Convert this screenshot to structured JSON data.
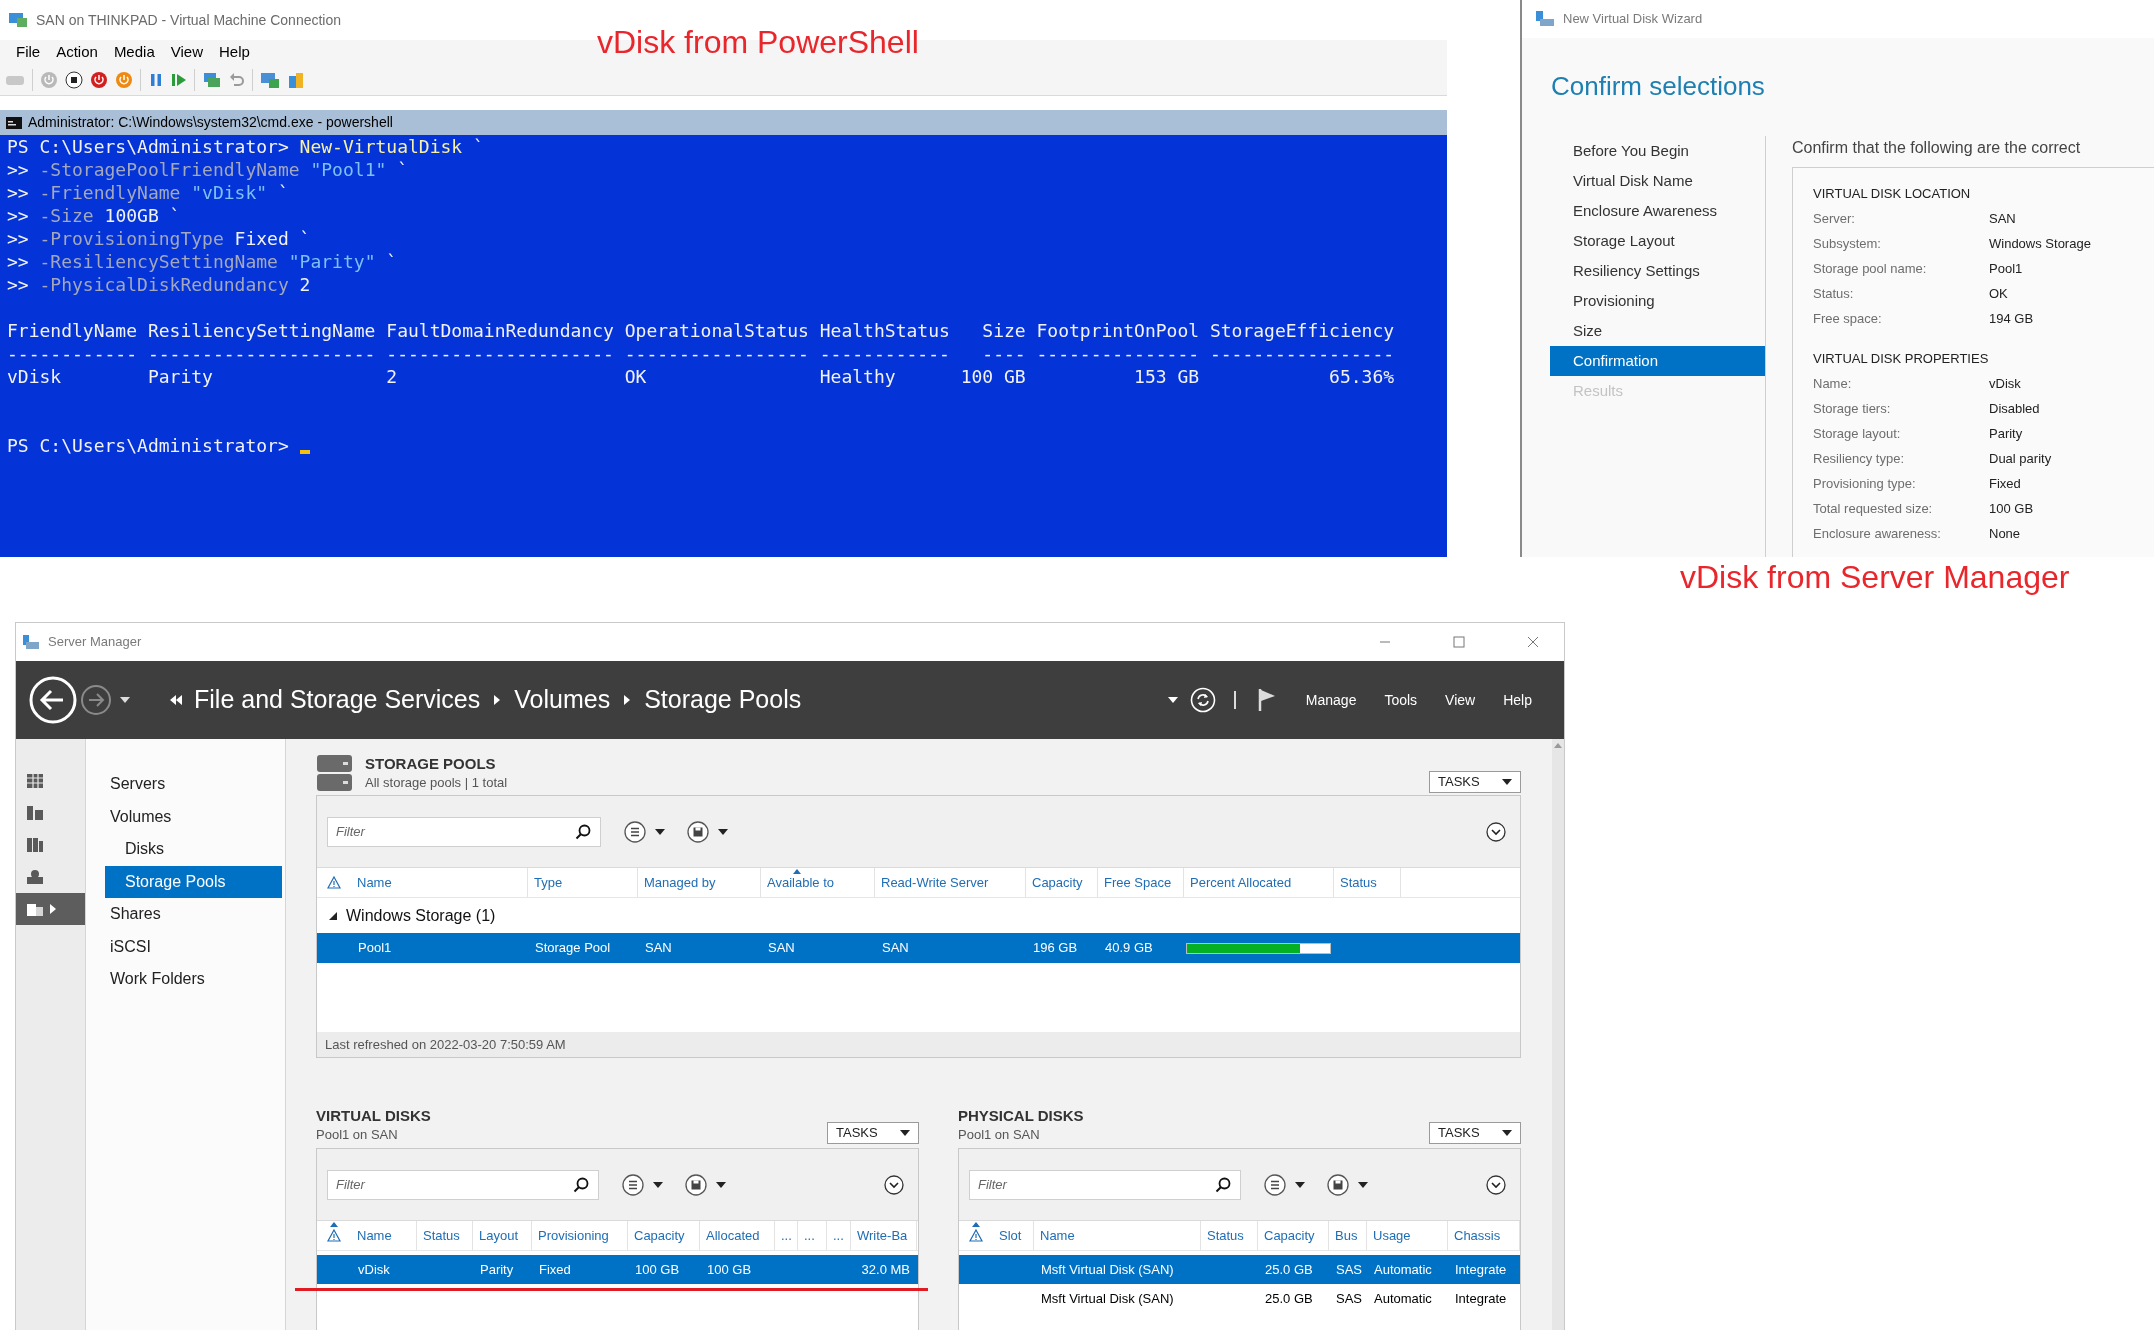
{
  "vm_window": {
    "title": "SAN on THINKPAD - Virtual Machine Connection",
    "menu": [
      "File",
      "Action",
      "Media",
      "View",
      "Help"
    ],
    "console": {
      "title": "Administrator: C:\\Windows\\system32\\cmd.exe - powershell",
      "command_lines": [
        [
          {
            "text": "PS C:\\Users\\Administrator> ",
            "kind": "prompt"
          },
          {
            "text": "New-VirtualDisk",
            "kind": "command"
          },
          {
            "text": " `",
            "kind": "plain"
          }
        ],
        [
          {
            "text": ">> ",
            "kind": "prompt"
          },
          {
            "text": "-StoragePoolFriendlyName",
            "kind": "param"
          },
          {
            "text": " \"Pool1\"",
            "kind": "string"
          },
          {
            "text": " `",
            "kind": "plain"
          }
        ],
        [
          {
            "text": ">> ",
            "kind": "prompt"
          },
          {
            "text": "-FriendlyName",
            "kind": "param"
          },
          {
            "text": " \"vDisk\"",
            "kind": "string"
          },
          {
            "text": " `",
            "kind": "plain"
          }
        ],
        [
          {
            "text": ">> ",
            "kind": "prompt"
          },
          {
            "text": "-Size",
            "kind": "param"
          },
          {
            "text": " 100GB `",
            "kind": "plain"
          }
        ],
        [
          {
            "text": ">> ",
            "kind": "prompt"
          },
          {
            "text": "-ProvisioningType",
            "kind": "param"
          },
          {
            "text": " Fixed `",
            "kind": "plain"
          }
        ],
        [
          {
            "text": ">> ",
            "kind": "prompt"
          },
          {
            "text": "-ResiliencySettingName",
            "kind": "param"
          },
          {
            "text": " \"Parity\"",
            "kind": "string"
          },
          {
            "text": " `",
            "kind": "plain"
          }
        ],
        [
          {
            "text": ">> ",
            "kind": "prompt"
          },
          {
            "text": "-PhysicalDiskRedundancy",
            "kind": "param"
          },
          {
            "text": " 2",
            "kind": "plain"
          }
        ]
      ],
      "output_lines": [
        "FriendlyName ResiliencySettingName FaultDomainRedundancy OperationalStatus HealthStatus   Size FootprintOnPool StorageEfficiency",
        "------------ --------------------- --------------------- ----------------- ------------   ---- --------------- -----------------",
        "vDisk        Parity                2                     OK                Healthy      100 GB          153 GB            65.36%"
      ],
      "prompt": "PS C:\\Users\\Administrator> "
    }
  },
  "annotations": [
    {
      "text": "vDisk from PowerShell"
    },
    {
      "text": "vDisk from Server Manager"
    }
  ],
  "wizard": {
    "title": "New Virtual Disk Wizard",
    "heading": "Confirm selections",
    "steps": [
      {
        "label": "Before You Begin",
        "selected": false,
        "disabled": false
      },
      {
        "label": "Virtual Disk Name",
        "selected": false,
        "disabled": false
      },
      {
        "label": "Enclosure Awareness",
        "selected": false,
        "disabled": false
      },
      {
        "label": "Storage Layout",
        "selected": false,
        "disabled": false
      },
      {
        "label": "Resiliency Settings",
        "selected": false,
        "disabled": false
      },
      {
        "label": "Provisioning",
        "selected": false,
        "disabled": false
      },
      {
        "label": "Size",
        "selected": false,
        "disabled": false
      },
      {
        "label": "Confirmation",
        "selected": true,
        "disabled": false
      },
      {
        "label": "Results",
        "selected": false,
        "disabled": true
      }
    ],
    "intro": "Confirm that the following are the correct",
    "sections": [
      {
        "heading": "VIRTUAL DISK LOCATION",
        "rows": [
          {
            "label": "Server:",
            "value": "SAN"
          },
          {
            "label": "Subsystem:",
            "value": "Windows Storage"
          },
          {
            "label": "Storage pool name:",
            "value": "Pool1"
          },
          {
            "label": "Status:",
            "value": "OK"
          },
          {
            "label": "Free space:",
            "value": "194 GB"
          }
        ]
      },
      {
        "heading": "VIRTUAL DISK PROPERTIES",
        "rows": [
          {
            "label": "Name:",
            "value": "vDisk"
          },
          {
            "label": "Storage tiers:",
            "value": "Disabled"
          },
          {
            "label": "Storage layout:",
            "value": "Parity"
          },
          {
            "label": "Resiliency type:",
            "value": "Dual parity"
          },
          {
            "label": "Provisioning type:",
            "value": "Fixed"
          },
          {
            "label": "Total requested size:",
            "value": "100 GB"
          },
          {
            "label": "Enclosure awareness:",
            "value": "None"
          }
        ]
      }
    ]
  },
  "server_manager": {
    "title": "Server Manager",
    "breadcrumb": [
      "File and Storage Services",
      "Volumes",
      "Storage Pools"
    ],
    "menu": [
      "Manage",
      "Tools",
      "View",
      "Help"
    ],
    "rail": [
      {
        "kind": "dashboard",
        "selected": false
      },
      {
        "kind": "local_server",
        "selected": false
      },
      {
        "kind": "all_servers",
        "selected": false
      },
      {
        "kind": "roles",
        "selected": false
      },
      {
        "kind": "file_storage",
        "selected": true
      }
    ],
    "nav": [
      {
        "label": "Servers",
        "selected": false
      },
      {
        "label": "Volumes",
        "selected": false,
        "children": [
          {
            "label": "Disks",
            "selected": false
          },
          {
            "label": "Storage Pools",
            "selected": true
          }
        ]
      },
      {
        "label": "Shares",
        "selected": false
      },
      {
        "label": "iSCSI",
        "selected": false
      },
      {
        "label": "Work Folders",
        "selected": false
      }
    ],
    "storage_pools": {
      "title": "STORAGE POOLS",
      "subtitle": "All storage pools | 1 total",
      "tasks": "TASKS",
      "filter_placeholder": "Filter",
      "columns": [
        {
          "label": "Name",
          "sorted": false
        },
        {
          "label": "Type",
          "sorted": false
        },
        {
          "label": "Managed by",
          "sorted": false
        },
        {
          "label": "Available to",
          "sorted": true
        },
        {
          "label": "Read-Write Server",
          "sorted": false
        },
        {
          "label": "Capacity",
          "sorted": false
        },
        {
          "label": "Free Space",
          "sorted": false
        },
        {
          "label": "Percent Allocated",
          "sorted": false
        },
        {
          "label": "Status",
          "sorted": false
        }
      ],
      "groups": [
        {
          "label": "Windows Storage (1)",
          "expanded": true,
          "rows": [
            {
              "selected": true,
              "name": "Pool1",
              "type": "Storage Pool",
              "managed_by": "SAN",
              "available_to": "SAN",
              "read_write_server": "SAN",
              "capacity": "196 GB",
              "free_space": "40.9 GB",
              "level": 0.79
            }
          ]
        }
      ],
      "footer": "Last refreshed on 2022-03-20 7:50:59 AM"
    },
    "virtual_disks": {
      "title": "VIRTUAL DISKS",
      "subtitle": "Pool1 on SAN",
      "tasks": "TASKS",
      "filter_placeholder": "Filter",
      "columns": [
        "Name",
        "Status",
        "Layout",
        "Provisioning",
        "Capacity",
        "Allocated",
        "...",
        "...",
        "...",
        "Write-Ba"
      ],
      "rows": [
        {
          "selected": true,
          "name": "vDisk",
          "layout": "Parity",
          "provisioning": "Fixed",
          "capacity": "100 GB",
          "allocated": "100 GB",
          "write_ba": "32.0 MB"
        }
      ]
    },
    "physical_disks": {
      "title": "PHYSICAL DISKS",
      "subtitle": "Pool1 on SAN",
      "tasks": "TASKS",
      "filter_placeholder": "Filter",
      "columns": [
        "Slot",
        "Name",
        "Status",
        "Capacity",
        "Bus",
        "Usage",
        "Chassis"
      ],
      "rows": [
        {
          "selected": true,
          "name": "Msft Virtual Disk (SAN)",
          "capacity": "25.0 GB",
          "bus": "SAS",
          "usage": "Automatic",
          "chassis": "Integrate"
        },
        {
          "selected": false,
          "name": "Msft Virtual Disk (SAN)",
          "capacity": "25.0 GB",
          "bus": "SAS",
          "usage": "Automatic",
          "chassis": "Integrate"
        }
      ]
    }
  }
}
